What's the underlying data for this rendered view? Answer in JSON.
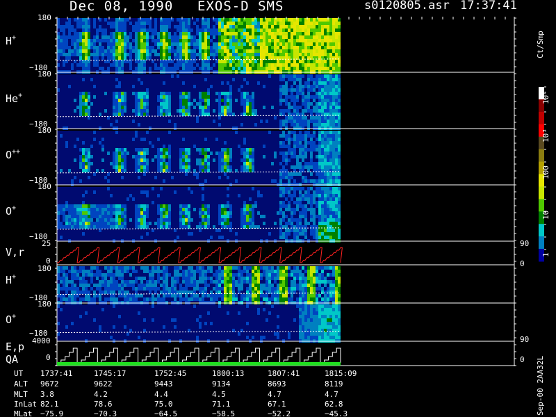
{
  "header": {
    "date": "Dec 08, 1990",
    "instrument": "EXOS-D SMS",
    "file_id": "s0120805.asr",
    "time": "17:37:41"
  },
  "colorbar": {
    "unit": "Ct/Smp",
    "ticks": [
      "10⁴",
      "10³",
      "100",
      "10",
      "1"
    ],
    "colors": [
      "#ffffff",
      "#8b0000",
      "#c00000",
      "#ff0000",
      "#5a4a20",
      "#8b7d10",
      "#b5a000",
      "#e6e600",
      "#c8e600",
      "#50c800",
      "#008000",
      "#00c8c8",
      "#0080c0",
      "#0000a0"
    ]
  },
  "panels": [
    {
      "id": "H+",
      "label": "H",
      "sup": "+",
      "ytop": "180",
      "ybot": "−180"
    },
    {
      "id": "He+",
      "label": "He",
      "sup": "+",
      "ytop": "180",
      "ybot": "−180"
    },
    {
      "id": "O++",
      "label": "O",
      "sup": "++",
      "ytop": "180",
      "ybot": "−180"
    },
    {
      "id": "O+",
      "label": "O",
      "sup": "+",
      "ytop": "180",
      "ybot": "−180"
    },
    {
      "id": "Vr",
      "label": "V,r",
      "sup": "",
      "ytop": "25",
      "ybot": "0",
      "rtop": "90",
      "rbot": "0"
    },
    {
      "id": "H+b",
      "label": "H",
      "sup": "+",
      "ytop": "180",
      "ybot": "−180"
    },
    {
      "id": "O+b",
      "label": "O",
      "sup": "+",
      "ytop": "180",
      "ybot": "−180",
      "rbot": "90"
    },
    {
      "id": "Ep",
      "label": "E,p",
      "label2": "QA",
      "sup": "",
      "ytop": "4000",
      "ybot": "0",
      "rbot": "0"
    }
  ],
  "footer": {
    "sep_label": "Sep-00  2AA32L",
    "rows": [
      {
        "name": "UT",
        "values": [
          "1737:41",
          "1745:17",
          "1752:45",
          "1800:13",
          "1807:41",
          "1815:09"
        ]
      },
      {
        "name": "ALT",
        "values": [
          "9672",
          "9622",
          "9443",
          "9134",
          "8693",
          "8119"
        ]
      },
      {
        "name": "MLT",
        "values": [
          "3.8",
          "4.2",
          "4.4",
          "4.5",
          "4.7",
          "4.7"
        ]
      },
      {
        "name": "InLat",
        "values": [
          "82.1",
          "78.6",
          "75.0",
          "71.1",
          "67.1",
          "62.8"
        ]
      },
      {
        "name": "MLat",
        "values": [
          "−75.9",
          "−70.3",
          "−64.5",
          "−58.5",
          "−52.2",
          "−45.3"
        ]
      }
    ]
  },
  "chart_data": {
    "type": "heatmap",
    "title": "Dec 08, 1990    EXOS-D SMS",
    "series": [
      {
        "name": "H+",
        "values": [
          "180",
          "−180"
        ]
      },
      {
        "name": "He+",
        "values": [
          "180",
          "−180"
        ]
      },
      {
        "name": "O++",
        "values": [
          "180",
          "−180"
        ]
      },
      {
        "name": "O+",
        "values": [
          "180",
          "−180"
        ]
      },
      {
        "name": "V,r",
        "values": [
          "25",
          "0"
        ]
      },
      {
        "name": "H+",
        "values": [
          "180",
          "−180"
        ]
      },
      {
        "name": "O+",
        "values": [
          "180",
          "−180"
        ]
      },
      {
        "name": "E,p",
        "values": [
          "4000",
          "0"
        ]
      }
    ],
    "x": [
      "1737:41",
      "1745:17",
      "1752:45",
      "1800:13",
      "1807:41",
      "1815:09"
    ],
    "xlabel": "UT",
    "colorbar_label": "Ct/Smp",
    "colorbar_range": [
      "1",
      "10⁴"
    ]
  }
}
